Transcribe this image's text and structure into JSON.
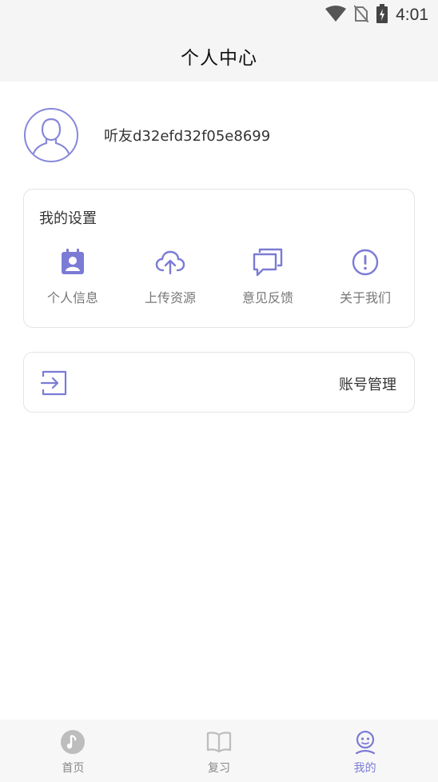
{
  "status_bar": {
    "time": "4:01",
    "icons": [
      "wifi-icon",
      "no-sim-icon",
      "battery-charging-icon"
    ]
  },
  "header": {
    "title": "个人中心"
  },
  "profile": {
    "avatar_icon": "user-avatar-icon",
    "username": "听友d32efd32f05e8699"
  },
  "settings": {
    "title": "我的设置",
    "items": [
      {
        "label": "个人信息",
        "icon": "id-card-icon"
      },
      {
        "label": "上传资源",
        "icon": "cloud-upload-icon"
      },
      {
        "label": "意见反馈",
        "icon": "feedback-chat-icon"
      },
      {
        "label": "关于我们",
        "icon": "info-exclamation-icon"
      }
    ]
  },
  "account": {
    "label": "账号管理",
    "icon": "logout-icon"
  },
  "bottom_nav": {
    "active_index": 2,
    "items": [
      {
        "label": "首页",
        "icon": "music-note-icon"
      },
      {
        "label": "复习",
        "icon": "book-icon"
      },
      {
        "label": "我的",
        "icon": "profile-face-icon"
      }
    ]
  },
  "colors": {
    "accent": "#7b7bd6",
    "nav_inactive": "#bdbdbd",
    "header_bg": "#f5f5f5"
  }
}
